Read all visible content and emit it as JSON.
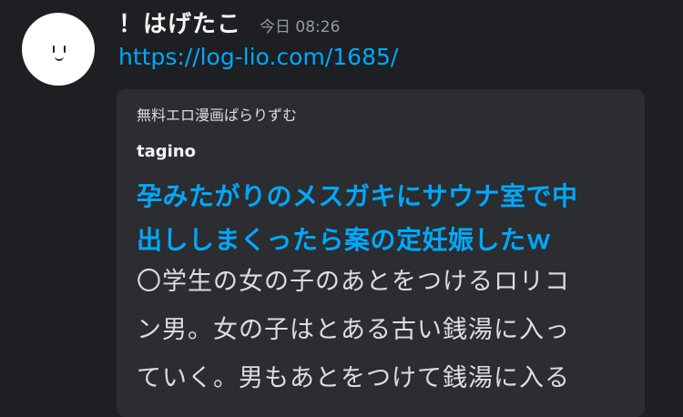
{
  "message": {
    "username": "！はげたこ",
    "timestamp": "今日 08:26",
    "link_text": "https://log-lio.com/1685/"
  },
  "embed": {
    "provider": "無料エロ漫画ぱらりずむ",
    "author": "tagino",
    "title": "孕みたがりのメスガキにサウナ室で中\n出ししまくったら案の定妊娠したｗ",
    "description": "〇学生の女の子のあとをつけるロリコ\nン男。女の子はとある古い銭湯に入っ\nていく。男もあとをつけて銭湯に入る"
  },
  "colors": {
    "background": "#1e1f22",
    "embed_background": "#2b2d31",
    "link": "#00a8fc",
    "muted_text": "#949ba4"
  }
}
